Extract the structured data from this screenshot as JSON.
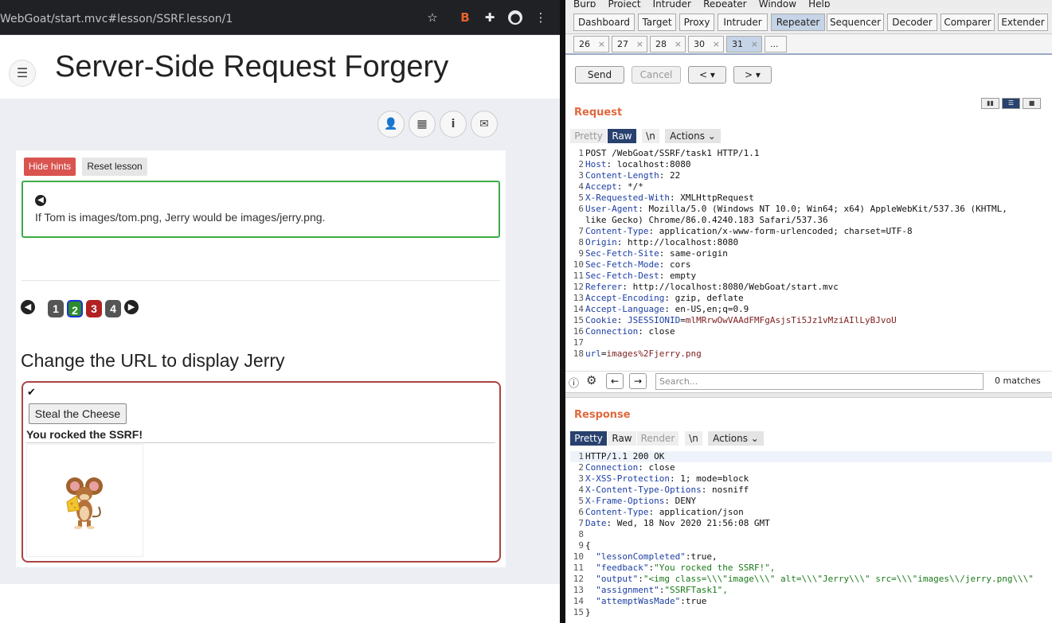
{
  "browser": {
    "url": "WebGoat/start.mvc#lesson/SSRF.lesson/1",
    "star_icon": "star-icon",
    "ext_icon": "burp-extension-icon",
    "puzzle_icon": "puzzle-icon",
    "profile_icon": "profile-icon",
    "menu_icon": "kebab-menu-icon"
  },
  "webgoat": {
    "title": "Server-Side Request Forgery",
    "hide_hints": "Hide hints",
    "reset_lesson": "Reset lesson",
    "hint_text": "If Tom is images/tom.png, Jerry would be images/jerry.png.",
    "pages": [
      "1",
      "2",
      "3",
      "4"
    ],
    "page_colors": [
      "#555555",
      "#2e8b2e",
      "#b22222",
      "#555555"
    ],
    "assignment_title": "Change the URL to display Jerry",
    "steal_button": "Steal the Cheese",
    "feedback": "You rocked the SSRF!",
    "image_alt": "Jerry"
  },
  "burp": {
    "menu": [
      "Burp",
      "Project",
      "Intruder",
      "Repeater",
      "Window",
      "Help"
    ],
    "tabs": [
      "Dashboard",
      "Target",
      "Proxy",
      "Intruder",
      "Repeater",
      "Sequencer",
      "Decoder",
      "Comparer",
      "Extender"
    ],
    "active_tab": "Repeater",
    "repeater_tabs": [
      "26",
      "27",
      "28",
      "30",
      "31",
      "..."
    ],
    "active_repeater_tab": "31",
    "send": "Send",
    "cancel": "Cancel",
    "back": "<",
    "forward": ">",
    "request_title": "Request",
    "response_title": "Response",
    "req_subtabs": [
      "Pretty",
      "Raw",
      "\\n",
      "Actions"
    ],
    "res_subtabs": [
      "Pretty",
      "Raw",
      "Render",
      "\\n",
      "Actions"
    ],
    "search_placeholder": "Search...",
    "matches": "0 matches",
    "request_lines": [
      {
        "k": "",
        "v": "POST /WebGoat/SSRF/task1 HTTP/1.1"
      },
      {
        "k": "Host",
        "v": " localhost:8080"
      },
      {
        "k": "Content-Length",
        "v": " 22"
      },
      {
        "k": "Accept",
        "v": " */*"
      },
      {
        "k": "X-Requested-With",
        "v": " XMLHttpRequest"
      },
      {
        "k": "User-Agent",
        "v": " Mozilla/5.0 (Windows NT 10.0; Win64; x64) AppleWebKit/537.36 (KHTML,"
      },
      {
        "k": "",
        "v": "like Gecko) Chrome/86.0.4240.183 Safari/537.36",
        "cont": true
      },
      {
        "k": "Content-Type",
        "v": " application/x-www-form-urlencoded; charset=UTF-8"
      },
      {
        "k": "Origin",
        "v": " http://localhost:8080"
      },
      {
        "k": "Sec-Fetch-Site",
        "v": " same-origin"
      },
      {
        "k": "Sec-Fetch-Mode",
        "v": " cors"
      },
      {
        "k": "Sec-Fetch-Dest",
        "v": " empty"
      },
      {
        "k": "Referer",
        "v": " http://localhost:8080/WebGoat/start.mvc"
      },
      {
        "k": "Accept-Encoding",
        "v": " gzip, deflate"
      },
      {
        "k": "Accept-Language",
        "v": " en-US,en;q=0.9"
      },
      {
        "k": "Cookie",
        "v": " ",
        "ck": "JSESSIONID",
        "cv": "mlMRrwOwVAAdFMFgAsjsTi5Jz1vMziAIlLyBJvoU"
      },
      {
        "k": "Connection",
        "v": " close"
      },
      {
        "k": "",
        "v": ""
      },
      {
        "k": "",
        "v": "",
        "pk": "url",
        "pv": "images%2Fjerry.png"
      }
    ],
    "response_lines": [
      {
        "k": "",
        "v": "HTTP/1.1 200 OK"
      },
      {
        "k": "Connection",
        "v": " close"
      },
      {
        "k": "X-XSS-Protection",
        "v": " 1; mode=block"
      },
      {
        "k": "X-Content-Type-Options",
        "v": " nosniff"
      },
      {
        "k": "X-Frame-Options",
        "v": " DENY"
      },
      {
        "k": "Content-Type",
        "v": " application/json"
      },
      {
        "k": "Date",
        "v": " Wed, 18 Nov 2020 21:56:08 GMT"
      },
      {
        "k": "",
        "v": ""
      },
      {
        "k": "",
        "v": "{"
      },
      {
        "k": "",
        "v": "",
        "jk": "  \"lessonCompleted\"",
        "jv": "true,",
        "jt": "plain"
      },
      {
        "k": "",
        "v": "",
        "jk": "  \"feedback\"",
        "jv": "\"You rocked the SSRF!\",",
        "jt": "str"
      },
      {
        "k": "",
        "v": "",
        "jk": "  \"output\"",
        "jv": "\"<img class=\\\\\\\"image\\\\\\\" alt=\\\\\\\"Jerry\\\\\\\" src=\\\\\\\"images\\\\/jerry.png\\\\\\\"",
        "jt": "str"
      },
      {
        "k": "",
        "v": "",
        "jk": "  \"assignment\"",
        "jv": "\"SSRFTask1\",",
        "jt": "str"
      },
      {
        "k": "",
        "v": "",
        "jk": "  \"attemptWasMade\"",
        "jv": "true",
        "jt": "plain"
      },
      {
        "k": "",
        "v": "}"
      }
    ]
  }
}
